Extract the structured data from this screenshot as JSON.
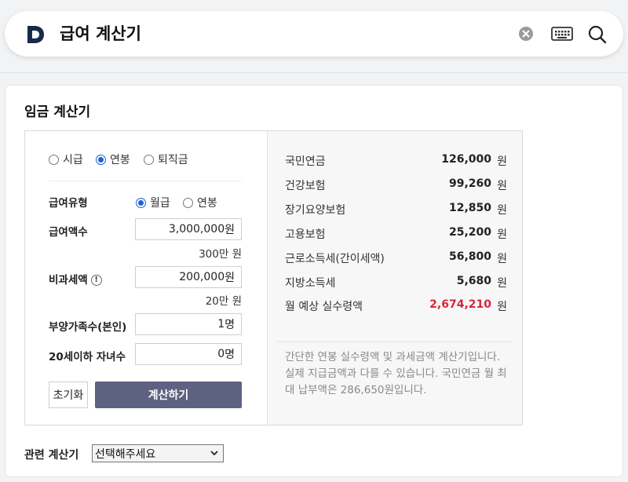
{
  "search": {
    "query": "급여 계산기",
    "logo_letter": "D"
  },
  "card": {
    "title": "임금 계산기"
  },
  "calc_mode": {
    "options": [
      "시급",
      "연봉",
      "퇴직금"
    ],
    "selected": "연봉"
  },
  "pay_type": {
    "label": "급여유형",
    "options": [
      "월급",
      "연봉"
    ],
    "selected": "월급"
  },
  "fields": {
    "salary": {
      "label": "급여액수",
      "value": "3,000,000",
      "unit": "원",
      "hint": "300만 원"
    },
    "nontax": {
      "label": "비과세액",
      "value": "200,000",
      "unit": "원",
      "hint": "20만 원"
    },
    "dependents": {
      "label": "부양가족수(본인)",
      "value": "1",
      "unit": "명"
    },
    "children": {
      "label": "20세이하 자녀수",
      "value": "0",
      "unit": "명"
    }
  },
  "buttons": {
    "reset": "초기화",
    "calculate": "계산하기"
  },
  "results": [
    {
      "label": "국민연금",
      "value": "126,000",
      "unit": "원"
    },
    {
      "label": "건강보험",
      "value": "99,260",
      "unit": "원"
    },
    {
      "label": "장기요양보험",
      "value": "12,850",
      "unit": "원"
    },
    {
      "label": "고용보험",
      "value": "25,200",
      "unit": "원"
    },
    {
      "label": "근로소득세(간이세액)",
      "value": "56,800",
      "unit": "원"
    },
    {
      "label": "지방소득세",
      "value": "5,680",
      "unit": "원"
    },
    {
      "label": "월 예상 실수령액",
      "value": "2,674,210",
      "unit": "원"
    }
  ],
  "note": "간단한 연봉 실수령액 및 과세금액 계산기입니다. 실제 지급금액과 다를 수 있습니다. 국민연금 월 최대 납부액은 286,650원입니다.",
  "related": {
    "label": "관련 계산기",
    "selected": "선택해주세요"
  },
  "colors": {
    "accent": "#1a62d6",
    "button": "#5d6282",
    "net_value": "#d6283c"
  }
}
